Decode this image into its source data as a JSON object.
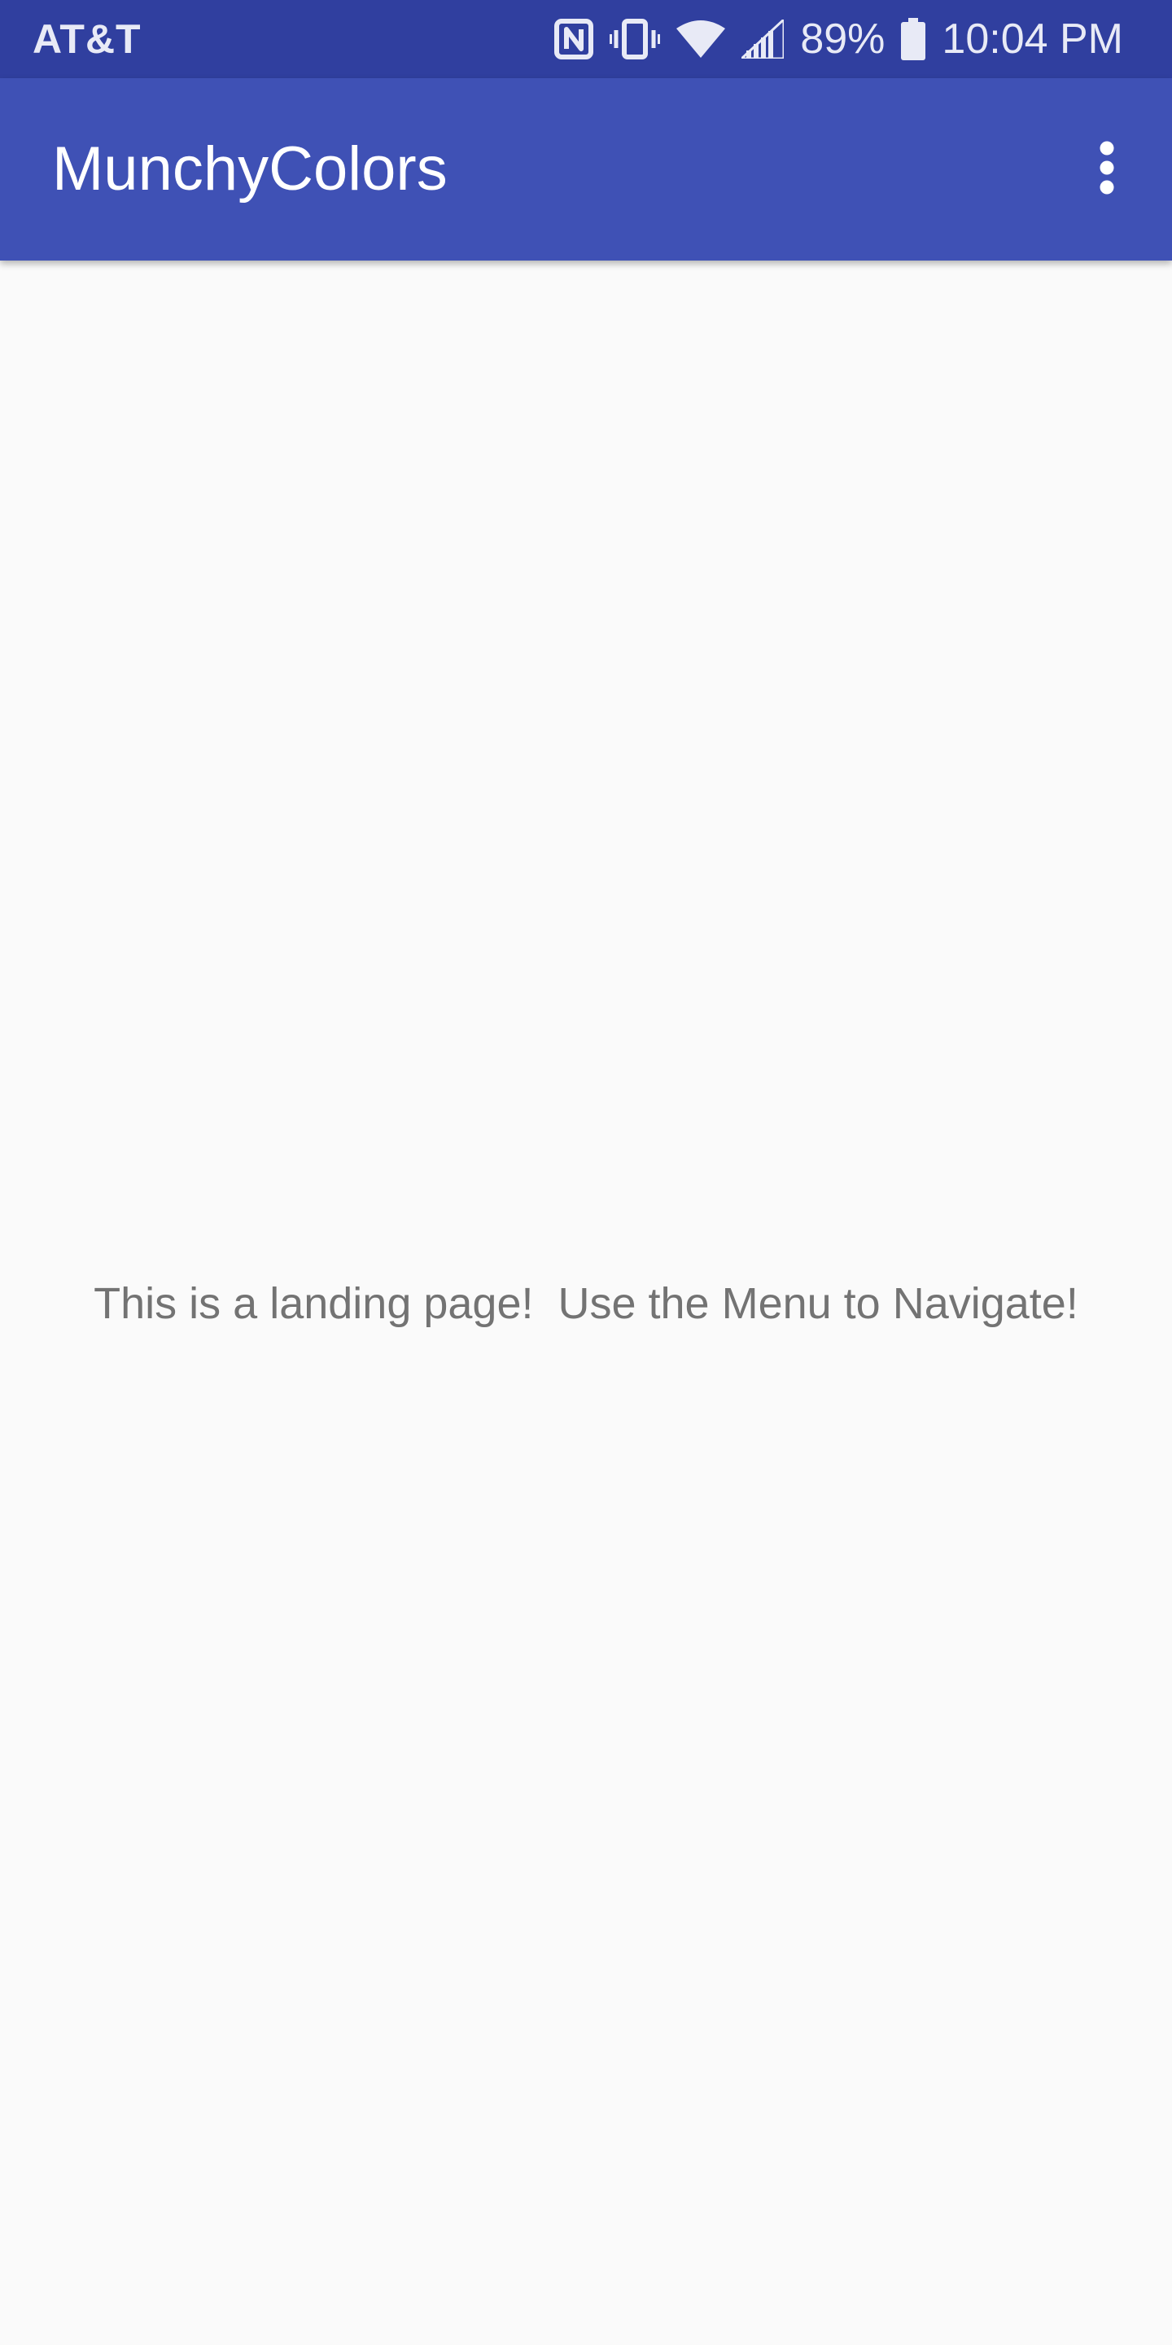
{
  "status_bar": {
    "carrier": "AT&T",
    "battery_percent": "89%",
    "time": "10:04 PM",
    "icons": [
      "nfc-icon",
      "vibrate-icon",
      "wifi-icon",
      "signal-icon",
      "battery-icon"
    ]
  },
  "app_bar": {
    "title": "MunchyColors",
    "overflow_icon": "more-vert-icon"
  },
  "main": {
    "landing_text": "This is a landing page!  Use the Menu to Navigate!"
  },
  "colors": {
    "status_bar": "#303f9f",
    "app_bar": "#3f51b5",
    "background": "#fafafa",
    "body_text": "#737373"
  }
}
